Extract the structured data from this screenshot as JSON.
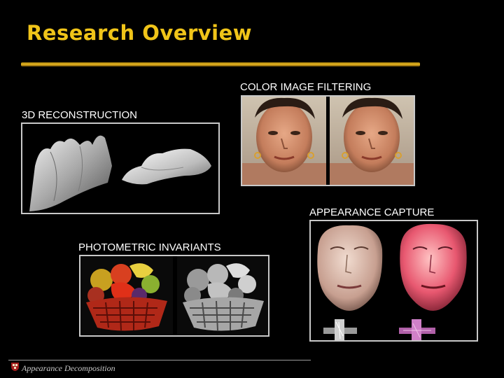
{
  "slide": {
    "title": "Research Overview",
    "footer": "Appearance Decomposition",
    "accent_color": "#f0c419"
  },
  "sections": {
    "color_filtering": {
      "label": "COLOR IMAGE FILTERING",
      "image": "woman-face-photo-pair"
    },
    "reconstruction": {
      "label": "3D RECONSTRUCTION",
      "image": "3d-mesh-surfaces"
    },
    "appearance": {
      "label": "APPEARANCE CAPTURE",
      "image": "rendered-face-masks"
    },
    "photometric": {
      "label": "PHOTOMETRIC INVARIANTS",
      "image": "fruit-basket-color-and-gray"
    }
  },
  "icons": {
    "footer_logo": "university-shield-icon"
  }
}
